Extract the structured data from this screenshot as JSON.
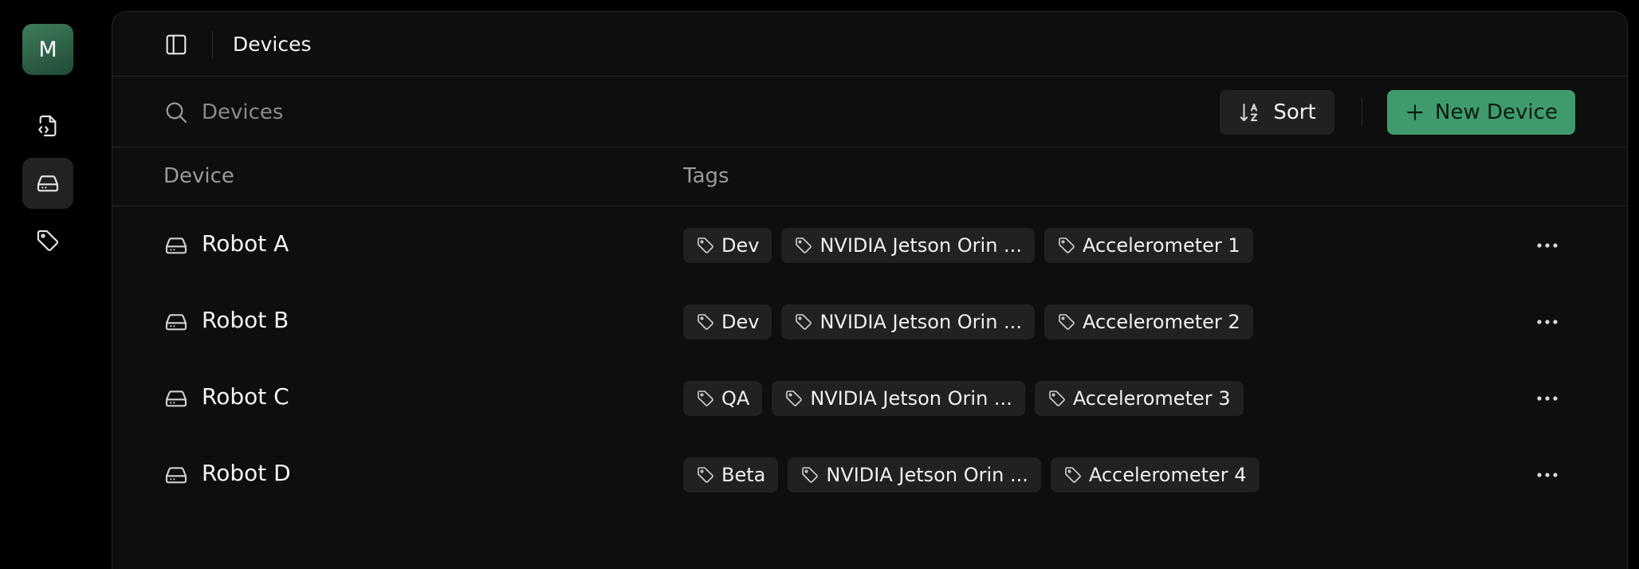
{
  "sidebar": {
    "avatar_initial": "M",
    "nav": [
      {
        "icon": "file-code-icon"
      },
      {
        "icon": "device-icon",
        "active": true
      },
      {
        "icon": "tag-icon"
      }
    ]
  },
  "header": {
    "title": "Devices"
  },
  "toolbar": {
    "search_placeholder": "Devices",
    "sort_label": "Sort",
    "new_label": "New Device"
  },
  "table": {
    "columns": [
      "Device",
      "Tags"
    ],
    "rows": [
      {
        "name": "Robot A",
        "tags": [
          "Dev",
          "NVIDIA Jetson Orin ...",
          "Accelerometer 1"
        ]
      },
      {
        "name": "Robot B",
        "tags": [
          "Dev",
          "NVIDIA Jetson Orin ...",
          "Accelerometer 2"
        ]
      },
      {
        "name": "Robot C",
        "tags": [
          "QA",
          "NVIDIA Jetson Orin ...",
          "Accelerometer 3"
        ]
      },
      {
        "name": "Robot D",
        "tags": [
          "Beta",
          "NVIDIA Jetson Orin ...",
          "Accelerometer 4"
        ]
      }
    ]
  },
  "colors": {
    "accent": "#3f9b6b",
    "panel": "#0e0e0e",
    "chip": "#212124"
  }
}
